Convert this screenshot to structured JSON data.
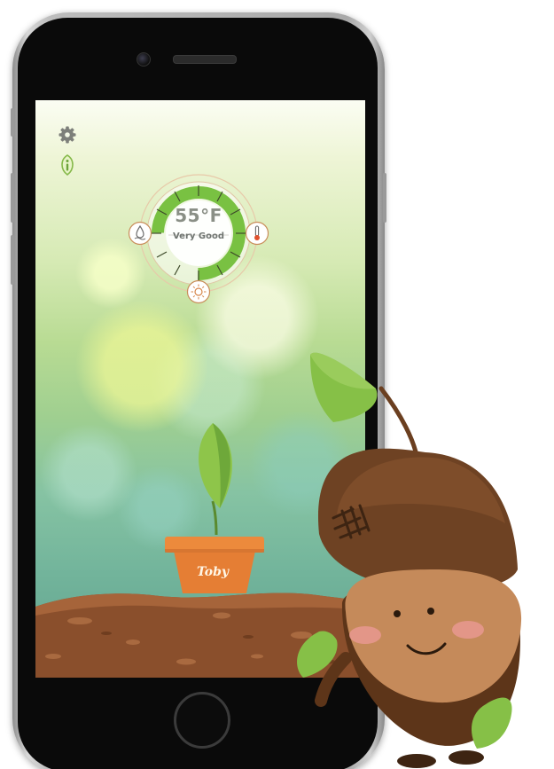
{
  "plant": {
    "name": "Toby"
  },
  "reading": {
    "temperature": "55°F",
    "status": "Very Good",
    "level": 0.75
  },
  "sidebar": {
    "items": [
      {
        "icon": "gear-icon"
      },
      {
        "icon": "info-icon"
      }
    ]
  },
  "gauge": {
    "sensors": [
      {
        "icon": "water-drop-icon"
      },
      {
        "icon": "thermometer-icon"
      },
      {
        "icon": "sun-icon"
      }
    ]
  },
  "colors": {
    "accent_green": "#79c142",
    "pot_orange": "#e57e34",
    "soil_brown": "#8a4f2c",
    "mascot_brown": "#6e4223"
  }
}
